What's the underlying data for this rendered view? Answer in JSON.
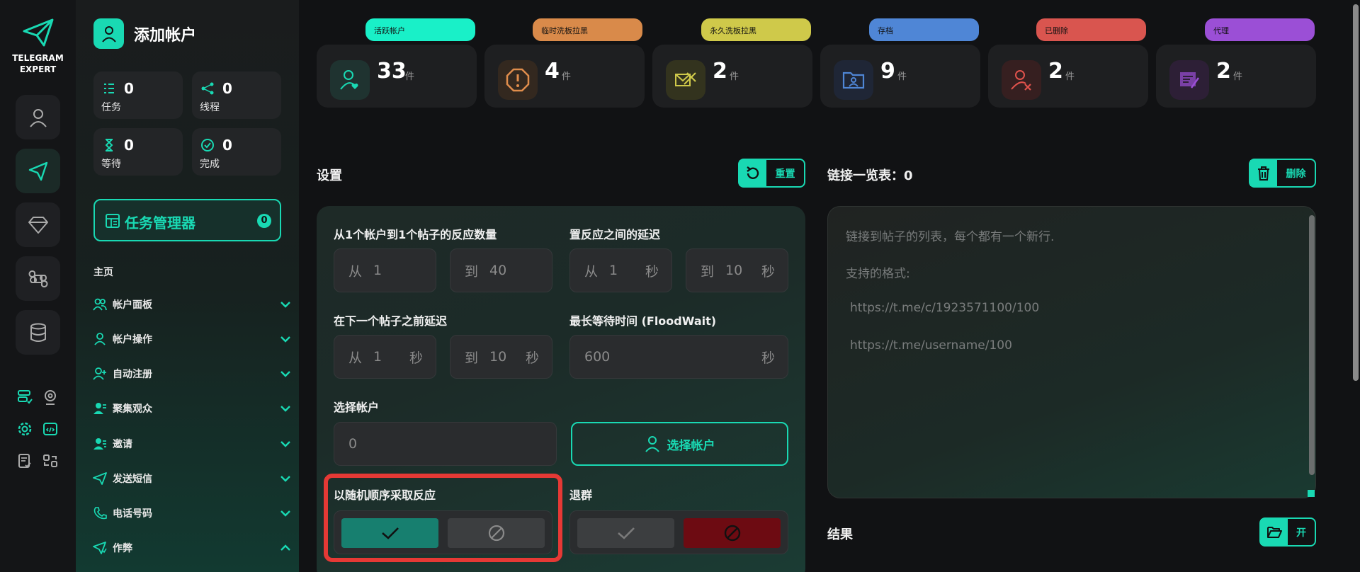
{
  "app": {
    "logo_line1": "TELEGRAM",
    "logo_line2": "EXPERT"
  },
  "sidebar": {
    "title": "添加帐户",
    "stats": [
      {
        "value": "0",
        "label": "任务",
        "icon": "tasks-icon"
      },
      {
        "value": "0",
        "label": "线程",
        "icon": "threads-icon"
      },
      {
        "value": "0",
        "label": "等待",
        "icon": "hourglass-icon"
      },
      {
        "value": "0",
        "label": "完成",
        "icon": "check-circle-icon"
      }
    ],
    "task_manager": {
      "label": "任务管理器",
      "count": "0"
    },
    "section_label": "主页",
    "nav": [
      {
        "label": "帐户面板",
        "icon": "users-icon"
      },
      {
        "label": "帐户操作",
        "icon": "user-icon"
      },
      {
        "label": "自动注册",
        "icon": "user-plus-icon"
      },
      {
        "label": "聚集观众",
        "icon": "user-group-icon"
      },
      {
        "label": "邀请",
        "icon": "user-list-icon"
      },
      {
        "label": "发送短信",
        "icon": "send-icon"
      },
      {
        "label": "电话号码",
        "icon": "phone-icon"
      },
      {
        "label": "作弊",
        "icon": "cheat-icon"
      }
    ]
  },
  "cards": [
    {
      "badge": "活跃帐户",
      "value": "33",
      "unit": "件",
      "color": "#19f0c8",
      "icon": "user-heart-icon"
    },
    {
      "badge": "临时洗板拉黑",
      "value": "4",
      "unit": "件",
      "color": "#d98a4a",
      "icon": "alert-octagon-icon"
    },
    {
      "badge": "永久洗板拉黑",
      "value": "2",
      "unit": "件",
      "color": "#cfc94a",
      "icon": "envelope-x-icon"
    },
    {
      "badge": "存档",
      "value": "9",
      "unit": "件",
      "color": "#4f86d6",
      "icon": "folder-user-icon"
    },
    {
      "badge": "已删除",
      "value": "2",
      "unit": "件",
      "color": "#d9554f",
      "icon": "user-x-icon"
    },
    {
      "badge": "代理",
      "value": "2",
      "unit": "件",
      "color": "#9b4fd6",
      "icon": "proxy-icon"
    }
  ],
  "settings": {
    "title": "设置",
    "reset_label": "重置",
    "reactions_label": "从1个帐户到1个帖子的反应数量",
    "reactions_from": {
      "prefix": "从",
      "value": "1"
    },
    "reactions_to": {
      "prefix": "到",
      "value": "40"
    },
    "delay_label": "置反应之间的延迟",
    "delay_from": {
      "prefix": "从",
      "value": "1",
      "suffix": "秒"
    },
    "delay_to": {
      "prefix": "到",
      "value": "10",
      "suffix": "秒"
    },
    "next_post_label": "在下一个帖子之前延迟",
    "next_from": {
      "prefix": "从",
      "value": "1",
      "suffix": "秒"
    },
    "next_to": {
      "prefix": "到",
      "value": "10",
      "suffix": "秒"
    },
    "floodwait_label": "最长等待时间 (FloodWait)",
    "floodwait": {
      "value": "600",
      "suffix": "秒"
    },
    "select_account_label": "选择帐户",
    "selected_count": "0",
    "select_account_button": "选择帐户",
    "random_order_label": "以随机顺序采取反应",
    "leave_group_label": "退群"
  },
  "links": {
    "title_prefix": "链接一览表：",
    "count": "0",
    "delete_label": "删除",
    "placeholder_line1": "链接到帖子的列表，每个都有一个新行.",
    "placeholder_line2": "支持的格式:",
    "placeholder_line3": "https://t.me/c/1923571100/100",
    "placeholder_line4": "https://t.me/username/100"
  },
  "results": {
    "title": "结果",
    "open_label": "开"
  },
  "colors": {
    "accent": "#19d9b3",
    "highlight": "#e53935",
    "danger_toggle": "#6d0b12"
  }
}
